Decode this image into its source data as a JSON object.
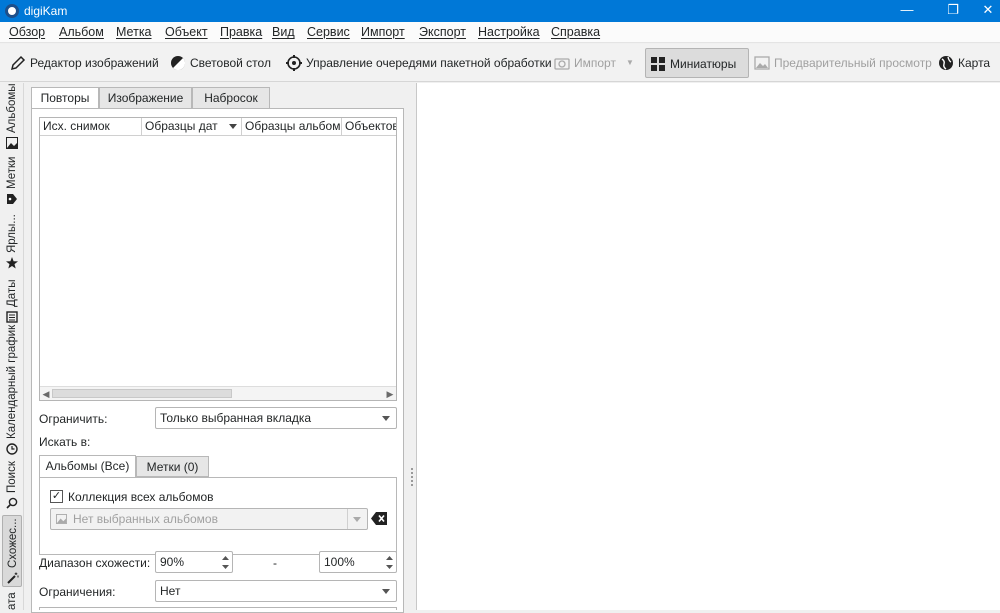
{
  "window": {
    "title": "digiKam",
    "minimize": "—",
    "maximize": "❐",
    "close": "✕"
  },
  "menu": [
    "Обзор",
    "Альбом",
    "Метка",
    "Объект",
    "Правка",
    "Вид",
    "Сервис",
    "Импорт",
    "Экспорт",
    "Настройка",
    "Справка"
  ],
  "toolbar": {
    "image_editor": "Редактор изображений",
    "light_table": "Световой стол",
    "batch_queue": "Управление очередями пакетной обработки",
    "import": "Импорт",
    "thumbnails": "Миниатюры",
    "preview": "Предварительный просмотр",
    "map": "Карта"
  },
  "sidebar_tabs": [
    "Альбомы",
    "Метки",
    "Ярлы...",
    "Даты",
    "Календарный график",
    "Поиск",
    "Схожес...",
    "ата"
  ],
  "panel": {
    "tabs": [
      "Повторы",
      "Изображение",
      "Набросок"
    ],
    "columns": [
      "Исх. снимок",
      "Образцы дат",
      "Образцы альбом",
      "Объектов"
    ],
    "restrict_label": "Ограничить:",
    "restrict_value": "Только выбранная вкладка",
    "search_in_label": "Искать в:",
    "subtabs": [
      "Альбомы (Все)",
      "Метки (0)"
    ],
    "all_albums_label": "Коллекция всех альбомов",
    "albums_placeholder": "Нет выбранных альбомов",
    "similarity_label": "Диапазон схожести:",
    "similarity_min": "90%",
    "range_sep": "-",
    "similarity_max": "100%",
    "constraints_label": "Ограничения:",
    "constraints_value": "Нет"
  }
}
